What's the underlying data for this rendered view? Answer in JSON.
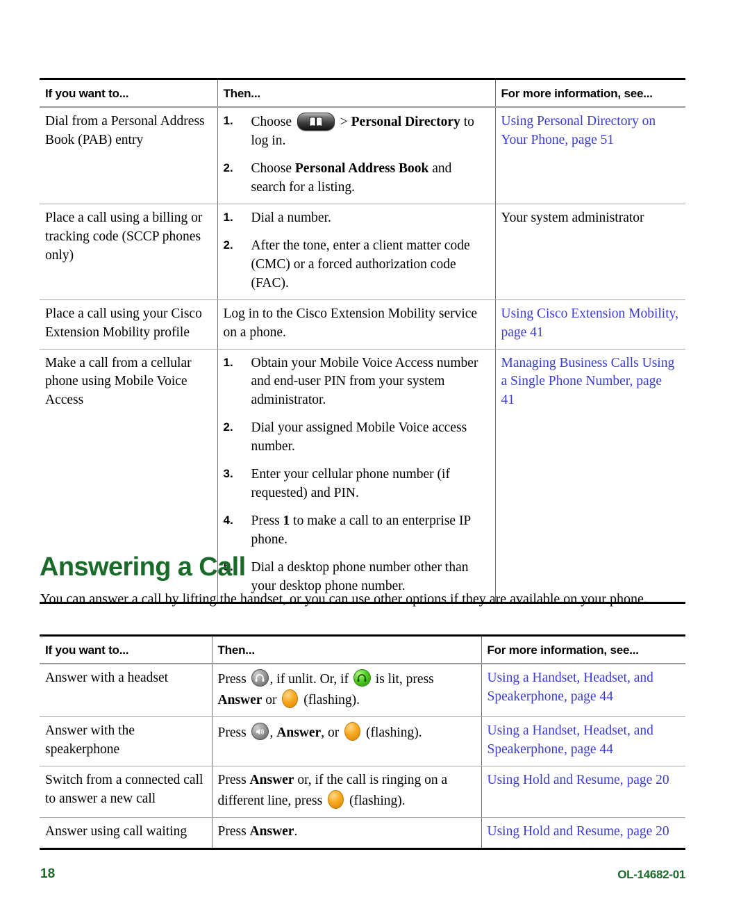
{
  "tables": [
    {
      "name": "dialing-options",
      "headers": [
        "If you want to...",
        "Then...",
        "For more information, see..."
      ],
      "rows": [
        {
          "want_to": "Dial from a Personal Address Book (PAB) entry",
          "steps": [
            {
              "num": "1.",
              "parts": [
                {
                  "t": "text",
                  "v": "Choose "
                },
                {
                  "t": "icon",
                  "v": "directories-button-icon"
                },
                {
                  "t": "text",
                  "v": " > "
                },
                {
                  "t": "bold",
                  "v": "Personal Directory"
                },
                {
                  "t": "text",
                  "v": " to log in."
                }
              ]
            },
            {
              "num": "2.",
              "parts": [
                {
                  "t": "text",
                  "v": "Choose "
                },
                {
                  "t": "bold",
                  "v": "Personal Address Book"
                },
                {
                  "t": "text",
                  "v": " and search for a listing."
                }
              ]
            }
          ],
          "more_info": {
            "link": true,
            "text": "Using Personal Directory on Your Phone, page 51"
          }
        },
        {
          "want_to": "Place a call using a billing or tracking code (SCCP phones only)",
          "steps": [
            {
              "num": "1.",
              "parts": [
                {
                  "t": "text",
                  "v": "Dial a number."
                }
              ]
            },
            {
              "num": "2.",
              "parts": [
                {
                  "t": "text",
                  "v": "After the tone, enter a client matter code (CMC) or a forced authorization code (FAC)."
                }
              ]
            }
          ],
          "more_info": {
            "link": false,
            "text": "Your system administrator"
          }
        },
        {
          "want_to": "Place a call using your Cisco Extension Mobility profile",
          "plain_then": "Log in to the Cisco Extension Mobility service on a phone.",
          "more_info": {
            "link": true,
            "text": "Using Cisco Extension Mobility, page 41"
          }
        },
        {
          "want_to": "Make a call from a cellular phone using Mobile Voice Access",
          "steps": [
            {
              "num": "1.",
              "parts": [
                {
                  "t": "text",
                  "v": "Obtain your Mobile Voice Access number and end-user PIN from your system administrator."
                }
              ]
            },
            {
              "num": "2.",
              "parts": [
                {
                  "t": "text",
                  "v": "Dial your assigned Mobile Voice access number."
                }
              ]
            },
            {
              "num": "3.",
              "parts": [
                {
                  "t": "text",
                  "v": "Enter your cellular phone number (if requested) and PIN."
                }
              ]
            },
            {
              "num": "4.",
              "parts": [
                {
                  "t": "text",
                  "v": "Press "
                },
                {
                  "t": "bold",
                  "v": "1"
                },
                {
                  "t": "text",
                  "v": " to make a call to an enterprise IP phone."
                }
              ]
            },
            {
              "num": "5.",
              "parts": [
                {
                  "t": "text",
                  "v": "Dial a desktop phone number other than your desktop phone number."
                }
              ]
            }
          ],
          "more_info": {
            "link": true,
            "text": "Managing Business Calls Using a Single Phone Number, page 41"
          }
        }
      ]
    },
    {
      "name": "answering-options",
      "headers": [
        "If you want to...",
        "Then...",
        "For more information, see..."
      ],
      "rows": [
        {
          "want_to": "Answer with a headset",
          "then_parts": [
            {
              "t": "text",
              "v": "Press "
            },
            {
              "t": "icon",
              "v": "headset-unlit-icon"
            },
            {
              "t": "text",
              "v": ", if unlit. Or, if "
            },
            {
              "t": "icon",
              "v": "headset-lit-icon"
            },
            {
              "t": "text",
              "v": " is lit, press "
            },
            {
              "t": "bold",
              "v": "Answer"
            },
            {
              "t": "text",
              "v": " or "
            },
            {
              "t": "icon",
              "v": "line-button-amber-icon"
            },
            {
              "t": "text",
              "v": " (flashing)."
            }
          ],
          "more_info": {
            "link": true,
            "text": "Using a Handset, Headset, and Speakerphone, page 44"
          }
        },
        {
          "want_to": "Answer with the speakerphone",
          "then_parts": [
            {
              "t": "text",
              "v": "Press "
            },
            {
              "t": "icon",
              "v": "speakerphone-icon"
            },
            {
              "t": "text",
              "v": ", "
            },
            {
              "t": "bold",
              "v": "Answer"
            },
            {
              "t": "text",
              "v": ", or "
            },
            {
              "t": "icon",
              "v": "line-button-amber-icon"
            },
            {
              "t": "text",
              "v": " (flashing)."
            }
          ],
          "more_info": {
            "link": true,
            "text": "Using a Handset, Headset, and Speakerphone, page 44"
          }
        },
        {
          "want_to": "Switch from a connected call to answer a new call",
          "then_parts": [
            {
              "t": "text",
              "v": "Press "
            },
            {
              "t": "bold",
              "v": "Answer"
            },
            {
              "t": "text",
              "v": " or, if the call is ringing on a different line, press "
            },
            {
              "t": "icon",
              "v": "line-button-amber-icon"
            },
            {
              "t": "text",
              "v": " (flashing)."
            }
          ],
          "more_info": {
            "link": true,
            "text": "Using Hold and Resume, page 20"
          }
        },
        {
          "want_to": "Answer using call waiting",
          "then_parts": [
            {
              "t": "text",
              "v": "Press "
            },
            {
              "t": "bold",
              "v": "Answer"
            },
            {
              "t": "text",
              "v": "."
            }
          ],
          "more_info": {
            "link": true,
            "text": "Using Hold and Resume, page 20"
          }
        }
      ]
    }
  ],
  "section": {
    "heading": "Answering a Call",
    "intro": "You can answer a call by lifting the handset, or you can use other options if they are available on your phone."
  },
  "footer": {
    "page_number": "18",
    "document_id": "OL-14682-01"
  },
  "colors": {
    "heading_green": "#1a6b2a",
    "link_blue": "#3b3bd4",
    "rule_black": "#000000",
    "rule_gray": "#a6a6a6",
    "amber_button": "#f7a81e",
    "lit_headset_green": "#4fce22"
  }
}
